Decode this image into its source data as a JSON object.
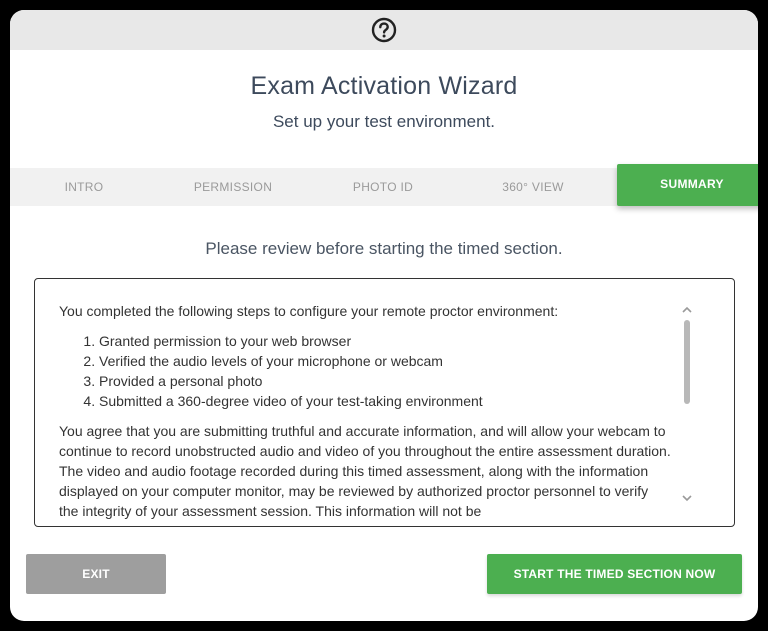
{
  "header": {
    "help_icon": "question-circle-icon"
  },
  "wizard": {
    "title": "Exam Activation Wizard",
    "subtitle": "Set up your test environment."
  },
  "steps": [
    {
      "label": "INTRO",
      "active": false
    },
    {
      "label": "PERMISSION",
      "active": false
    },
    {
      "label": "PHOTO ID",
      "active": false
    },
    {
      "label": "360° VIEW",
      "active": false
    },
    {
      "label": "SUMMARY",
      "active": true
    }
  ],
  "review": {
    "heading": "Please review before starting the timed section.",
    "intro": "You completed the following steps to configure your remote proctor environment:",
    "steps_done": [
      "Granted permission to your web browser",
      "Verified the audio levels of your microphone or webcam",
      "Provided a personal photo",
      "Submitted a 360-degree video of your test-taking environment"
    ],
    "agreement": "You agree that you are submitting truthful and accurate information, and will allow your webcam to continue to record unobstructed audio and video of you throughout the entire assessment duration. The video and audio footage recorded during this timed assessment, along with the information displayed on your computer monitor, may be reviewed by authorized proctor personnel to verify the integrity of your assessment session. This information will not be"
  },
  "actions": {
    "exit_label": "EXIT",
    "start_label": "START THE TIMED SECTION NOW"
  },
  "colors": {
    "accent_green": "#4caf50",
    "exit_gray": "#9e9e9e",
    "title_text": "#3d4a5c"
  }
}
